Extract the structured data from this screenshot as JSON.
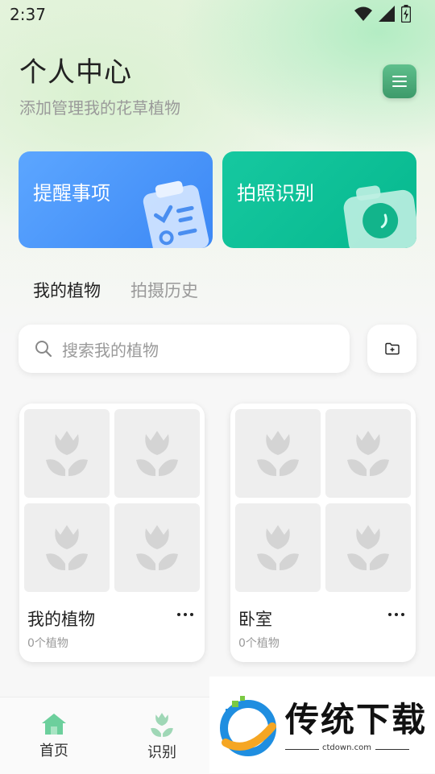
{
  "status": {
    "time": "2:37"
  },
  "header": {
    "title": "个人中心",
    "subtitle": "添加管理我的花草植物",
    "menu_icon": "hamburger-icon"
  },
  "cards": {
    "reminder_label": "提醒事项",
    "photo_label": "拍照识别"
  },
  "tabs": [
    {
      "label": "我的植物"
    },
    {
      "label": "拍摄历史"
    }
  ],
  "search": {
    "placeholder": "搜索我的植物"
  },
  "albums": [
    {
      "name": "我的植物",
      "count": "0个植物"
    },
    {
      "name": "卧室",
      "count": "0个植物"
    }
  ],
  "nav": {
    "home_label": "首页",
    "identify_label": "识别"
  },
  "watermark": {
    "title": "传统下载",
    "url": "ctdown.com"
  },
  "colors": {
    "brand_green": "#4aae7b",
    "reminder_blue": "#4a97fb",
    "photo_teal": "#0fc299"
  }
}
